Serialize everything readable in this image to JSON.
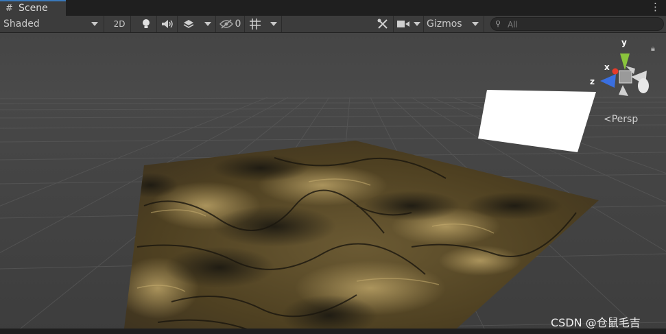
{
  "tab": {
    "icon": "grid-icon",
    "label": "Scene"
  },
  "toolbar": {
    "shading_mode": "Shaded",
    "mode_2d": "2D",
    "hidden_count": "0",
    "gizmos_label": "Gizmos",
    "search_placeholder": "All"
  },
  "gizmo": {
    "x": "x",
    "y": "y",
    "z": "z",
    "projection": "Persp"
  },
  "watermark": "CSDN @仓鼠毛吉",
  "colors": {
    "tab_accent": "#3a79bb",
    "gizmo_x": "#e83b2a",
    "gizmo_y": "#8ac43c",
    "gizmo_z": "#3a6fe0"
  }
}
